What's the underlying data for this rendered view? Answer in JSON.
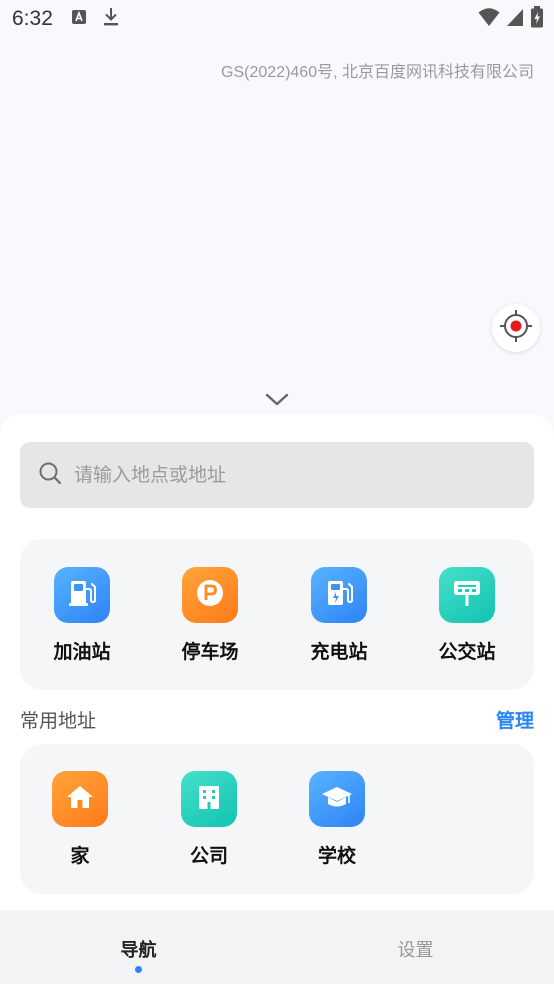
{
  "status_bar": {
    "time": "6:32",
    "icons": [
      "font-download-icon",
      "download-icon",
      "wifi-icon",
      "signal-icon",
      "battery-icon"
    ]
  },
  "map": {
    "copyright": "GS(2022)460号, 北京百度网讯科技有限公司",
    "locate_icon": "locate-icon",
    "collapse_icon": "chevron-down-icon"
  },
  "search": {
    "placeholder": "请输入地点或地址",
    "value": ""
  },
  "poi_categories": [
    {
      "label": "加油站",
      "icon": "fuel-pump-icon",
      "color": "#3d95fb"
    },
    {
      "label": "停车场",
      "icon": "parking-icon",
      "color": "#ff8a22"
    },
    {
      "label": "充电站",
      "icon": "charging-station-icon",
      "color": "#3d95fb"
    },
    {
      "label": "公交站",
      "icon": "bus-stop-icon",
      "color": "#1fcdb8"
    }
  ],
  "favorites": {
    "title": "常用地址",
    "manage_label": "管理",
    "items": [
      {
        "label": "家",
        "icon": "home-icon",
        "color": "#ff8a22"
      },
      {
        "label": "公司",
        "icon": "office-building-icon",
        "color": "#1fcdb8"
      },
      {
        "label": "学校",
        "icon": "graduation-cap-icon",
        "color": "#3d95fb"
      }
    ]
  },
  "tabs": [
    {
      "label": "导航",
      "active": true
    },
    {
      "label": "设置",
      "active": false
    }
  ],
  "colors": {
    "accent": "#2a86f0",
    "locate_red": "#e51b1b"
  }
}
